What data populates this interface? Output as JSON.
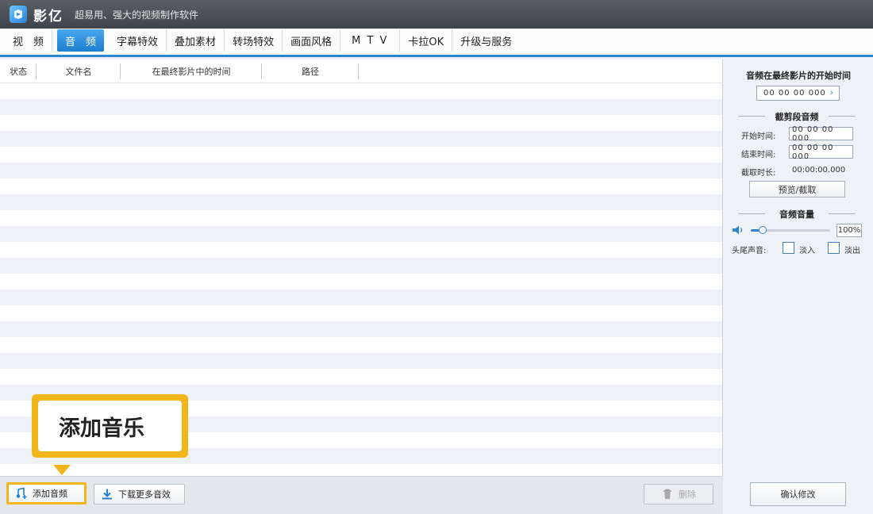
{
  "app": {
    "name": "影亿",
    "tagline": "超易用、强大的视频制作软件"
  },
  "tabs": [
    {
      "label": "视　频"
    },
    {
      "label": "音　频",
      "active": true
    },
    {
      "label": "字幕特效"
    },
    {
      "label": "叠加素材"
    },
    {
      "label": "转场特效"
    },
    {
      "label": "画面风格"
    },
    {
      "label": "M T V"
    },
    {
      "label": "卡拉OK"
    },
    {
      "label": "升级与服务"
    }
  ],
  "table": {
    "columns": [
      "状态",
      "文件名",
      "在最终影片中的时间",
      "路径"
    ],
    "rows": []
  },
  "callout": {
    "text": "添加音乐"
  },
  "bottom": {
    "add_audio": "添加音频",
    "download_more": "下载更多音效",
    "delete": "删除"
  },
  "right_panel": {
    "start_time_title": "音频在最终影片的开始时间",
    "start_time_value": "00 00 00 000",
    "trim_section": "截剪段音频",
    "start_label": "开始时间:",
    "start_value": "00 00 00 000",
    "end_label": "结束时间:",
    "end_value": "00 00 00 000",
    "duration_label": "截取时长:",
    "duration_value": "00:00:00.000",
    "preview_button": "预览/截取",
    "volume_section": "音频音量",
    "volume_value": "100%",
    "volume_level": 0.15,
    "fade_label": "头尾声音:",
    "fade_in": "淡入",
    "fade_out": "淡出",
    "confirm_button": "确认修改"
  },
  "colors": {
    "accent": "#2b86cf",
    "callout": "#f2b51a"
  }
}
